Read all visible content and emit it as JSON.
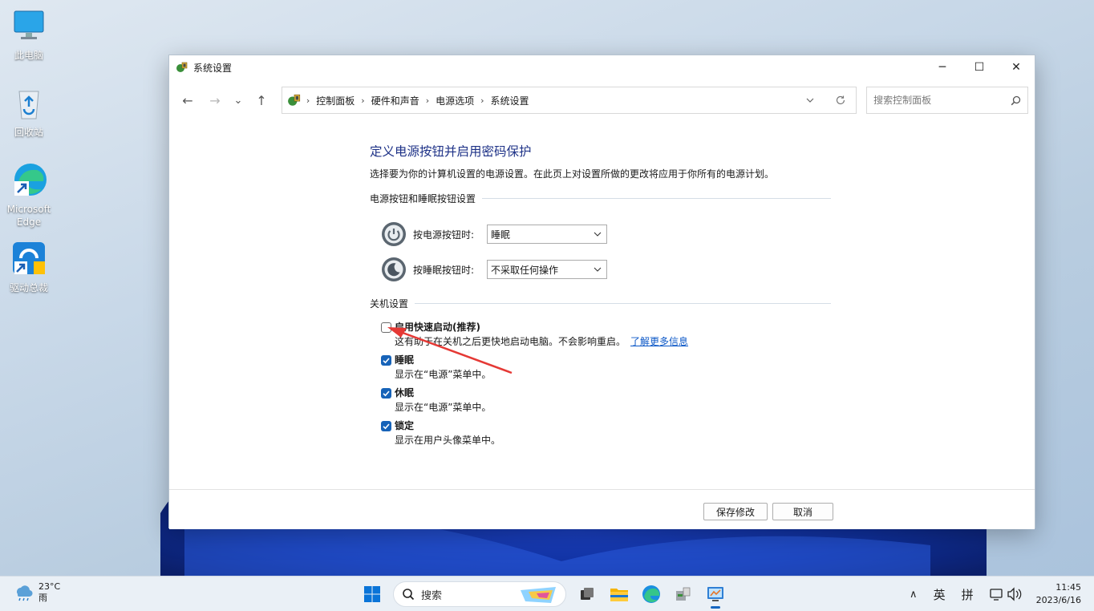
{
  "desktop": {
    "icons": [
      {
        "label": "此电脑"
      },
      {
        "label": "回收站"
      },
      {
        "label": "Microsoft Edge"
      },
      {
        "label": "驱动总裁"
      }
    ]
  },
  "window": {
    "title": "系统设置",
    "controls": {
      "minimize": "─",
      "maximize": "☐",
      "close": "✕"
    }
  },
  "nav": {
    "back": "←",
    "forward": "→",
    "recent": "⌄",
    "up": "↑"
  },
  "address": {
    "crumbs": [
      "控制面板",
      "硬件和声音",
      "电源选项",
      "系统设置"
    ],
    "separator": "›"
  },
  "search": {
    "placeholder": "搜索控制面板"
  },
  "page": {
    "heading": "定义电源按钮并启用密码保护",
    "description": "选择要为你的计算机设置的电源设置。在此页上对设置所做的更改将应用于你所有的电源计划。",
    "section_buttons": "电源按钮和睡眠按钮设置",
    "power_button_label": "按电源按钮时:",
    "power_button_value": "睡眠",
    "sleep_button_label": "按睡眠按钮时:",
    "sleep_button_value": "不采取任何操作",
    "section_shutdown": "关机设置",
    "options": [
      {
        "title": "启用快速启动(推荐)",
        "desc": "这有助于在关机之后更快地启动电脑。不会影响重启。",
        "link": "了解更多信息",
        "checked": false
      },
      {
        "title": "睡眠",
        "desc": "显示在“电源”菜单中。",
        "checked": true
      },
      {
        "title": "休眠",
        "desc": "显示在“电源”菜单中。",
        "checked": true
      },
      {
        "title": "锁定",
        "desc": "显示在用户头像菜单中。",
        "checked": true
      }
    ]
  },
  "footer": {
    "save": "保存修改",
    "cancel": "取消"
  },
  "taskbar": {
    "weather_temp": "23°C",
    "weather_cond": "雨",
    "search_label": "搜索",
    "tray_lang1": "英",
    "tray_lang2": "拼",
    "time": "11:45",
    "date": "2023/6/16",
    "chevron": "∧"
  },
  "colors": {
    "heading": "#1e3287",
    "link": "#0b57c7",
    "checkbox": "#1763b8",
    "annotation_arrow": "#e53935"
  }
}
